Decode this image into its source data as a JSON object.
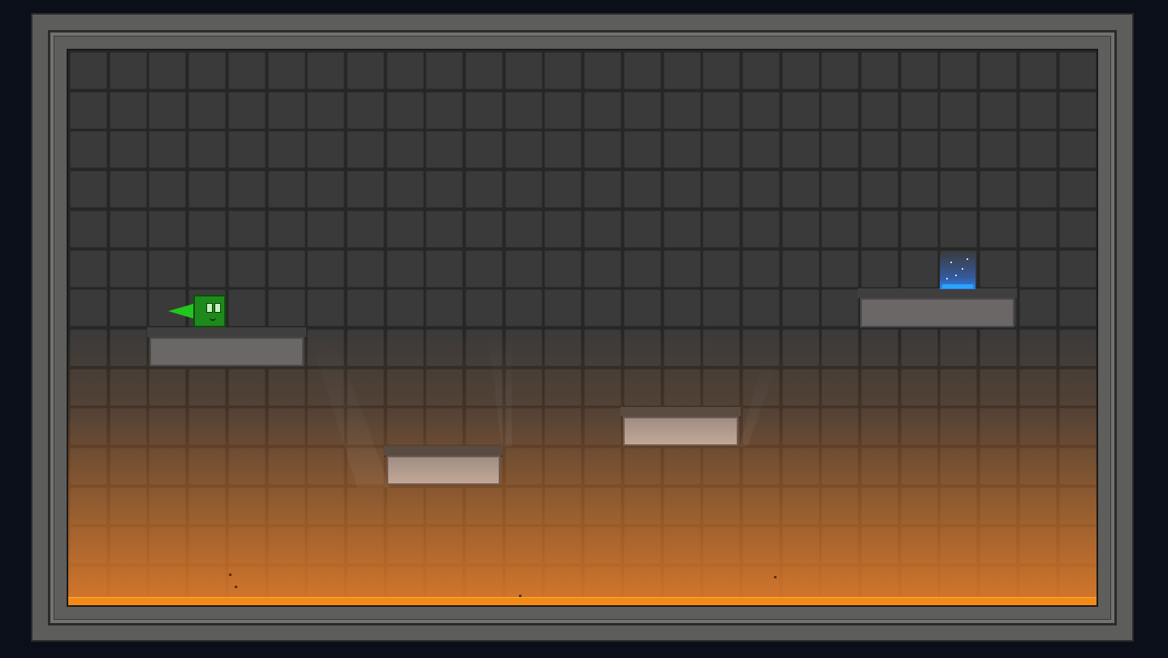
{
  "game": {
    "scene": "level",
    "player": {
      "character": "green-cube",
      "facing": "left"
    },
    "goal": {
      "type": "portal",
      "color": "#2aa4ff"
    },
    "hazard": {
      "type": "lava",
      "color": "#f28a17"
    }
  },
  "colors": {
    "background": "#0a0f1a",
    "frame": "#5d5d5b",
    "tile": "#3a3a3a",
    "player": "#1e8a1c",
    "arrow": "#22c61e",
    "lava": "#f28a17",
    "portal": "#2aa4ff"
  }
}
